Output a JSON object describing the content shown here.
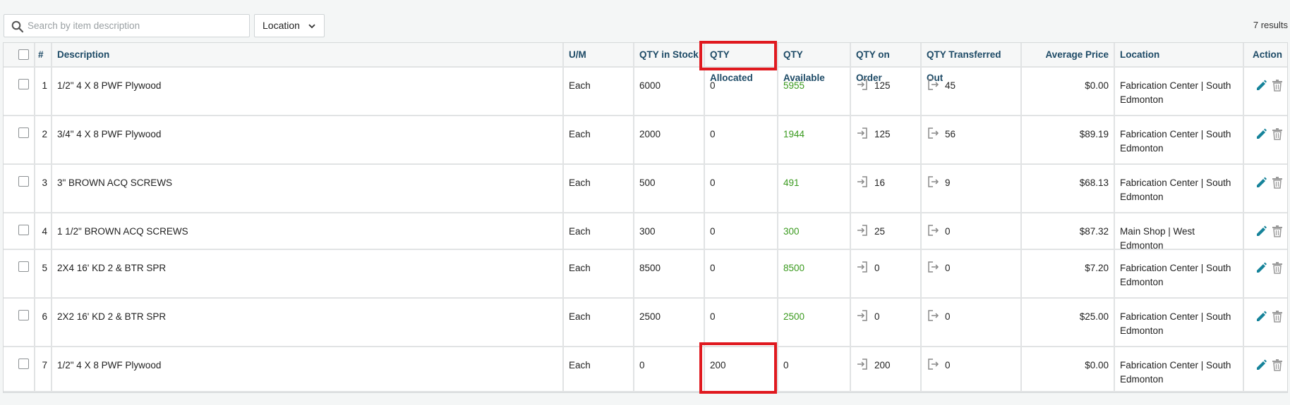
{
  "search": {
    "placeholder": "Search by item description",
    "value": ""
  },
  "location_filter": {
    "label": "Location"
  },
  "results_text": "7 results",
  "columns": {
    "num": "#",
    "description": "Description",
    "um": "U/M",
    "qty_in_stock": "QTY in Stock",
    "qty_allocated": "QTY Allocated",
    "qty_available": "QTY Available",
    "qty_on_order": "QTY on Order",
    "qty_transferred_out": "QTY Transferred Out",
    "average_price": "Average Price",
    "location": "Location",
    "action": "Action"
  },
  "rows": [
    {
      "num": "1",
      "description": "1/2\" 4 X 8 PWF Plywood",
      "um": "Each",
      "qty_in_stock": "6000",
      "qty_allocated": "0",
      "qty_available": "5955",
      "qty_on_order": "125",
      "qty_transferred_out": "45",
      "average_price": "$0.00",
      "location_line1": "Fabrication Center | South",
      "location_line2": "Edmonton"
    },
    {
      "num": "2",
      "description": "3/4\" 4 X 8 PWF Plywood",
      "um": "Each",
      "qty_in_stock": "2000",
      "qty_allocated": "0",
      "qty_available": "1944",
      "qty_on_order": "125",
      "qty_transferred_out": "56",
      "average_price": "$89.19",
      "location_line1": "Fabrication Center | South",
      "location_line2": "Edmonton"
    },
    {
      "num": "3",
      "description": "3\" BROWN ACQ SCREWS",
      "um": "Each",
      "qty_in_stock": "500",
      "qty_allocated": "0",
      "qty_available": "491",
      "qty_on_order": "16",
      "qty_transferred_out": "9",
      "average_price": "$68.13",
      "location_line1": "Fabrication Center | South",
      "location_line2": "Edmonton"
    },
    {
      "num": "4",
      "description": "1 1/2\" BROWN ACQ SCREWS",
      "um": "Each",
      "qty_in_stock": "300",
      "qty_allocated": "0",
      "qty_available": "300",
      "qty_on_order": "25",
      "qty_transferred_out": "0",
      "average_price": "$87.32",
      "location_line1": "Main Shop | West Edmonton",
      "location_line2": ""
    },
    {
      "num": "5",
      "description": "2X4 16' KD 2 & BTR SPR",
      "um": "Each",
      "qty_in_stock": "8500",
      "qty_allocated": "0",
      "qty_available": "8500",
      "qty_on_order": "0",
      "qty_transferred_out": "0",
      "average_price": "$7.20",
      "location_line1": "Fabrication Center | South",
      "location_line2": "Edmonton"
    },
    {
      "num": "6",
      "description": "2X2 16' KD 2 & BTR SPR",
      "um": "Each",
      "qty_in_stock": "2500",
      "qty_allocated": "0",
      "qty_available": "2500",
      "qty_on_order": "0",
      "qty_transferred_out": "0",
      "average_price": "$25.00",
      "location_line1": "Fabrication Center | South",
      "location_line2": "Edmonton"
    },
    {
      "num": "7",
      "description": "1/2\" 4 X 8 PWF Plywood",
      "um": "Each",
      "qty_in_stock": "0",
      "qty_allocated": "200",
      "qty_available": "0",
      "qty_on_order": "200",
      "qty_transferred_out": "0",
      "average_price": "$0.00",
      "location_line1": "Fabrication Center | South",
      "location_line2": "Edmonton"
    }
  ],
  "icons": {
    "search": "search-icon",
    "dropdown": "chevron-down-icon",
    "on_order": "arrow-into-box-icon",
    "transferred_out": "arrow-out-of-box-icon",
    "edit": "pencil-icon",
    "delete": "trash-icon"
  },
  "colors": {
    "header_text": "#1d4a66",
    "available_text": "#3a9a1e",
    "edit_icon": "#16839a",
    "highlight_box": "#e0191f"
  }
}
